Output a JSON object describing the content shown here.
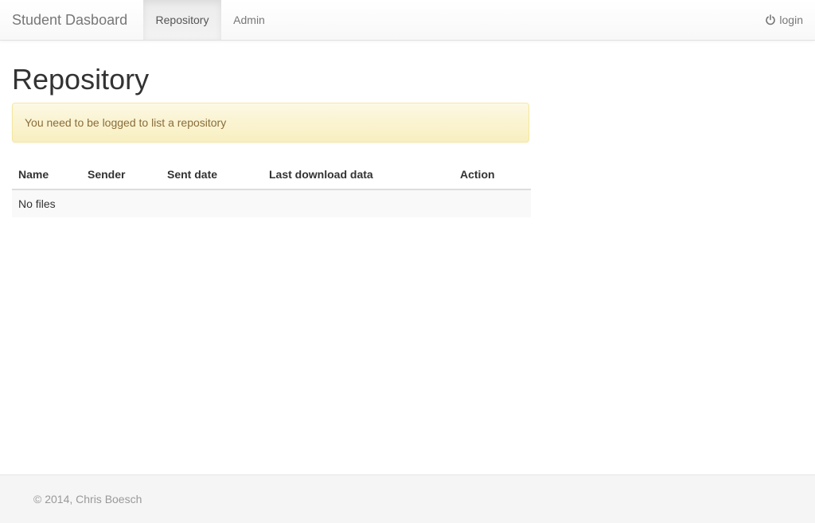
{
  "navbar": {
    "brand": "Student Dasboard",
    "items": [
      {
        "label": "Repository",
        "active": true
      },
      {
        "label": "Admin",
        "active": false
      }
    ],
    "login_label": "login",
    "login_icon": "power-icon"
  },
  "main": {
    "title": "Repository",
    "alert": "You need to be logged to list a repository",
    "table": {
      "headers": [
        "Name",
        "Sender",
        "Sent date",
        "Last download data",
        "Action"
      ],
      "empty_text": "No files"
    }
  },
  "footer": {
    "text": "© 2014, Chris Boesch"
  },
  "colors": {
    "alert_text": "#8a6d3b",
    "alert_background": "#fcf8e3",
    "alert_border": "#f5e79e",
    "navbar_text": "#777777",
    "footer_background": "#f5f5f5"
  }
}
